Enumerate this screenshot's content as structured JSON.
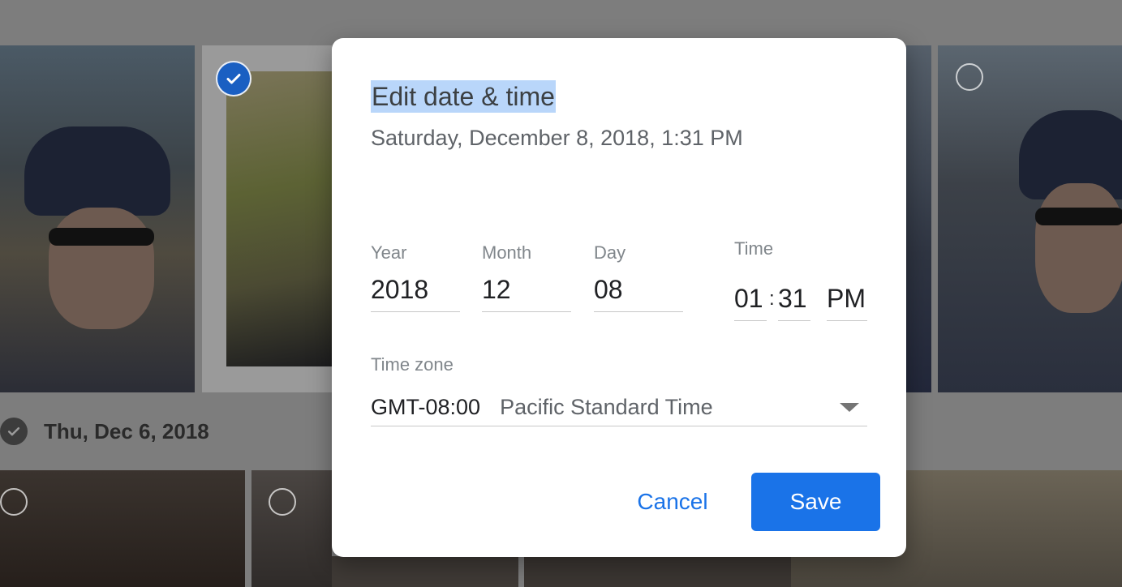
{
  "gallery": {
    "date_group_label": "Thu, Dec 6, 2018"
  },
  "dialog": {
    "title": "Edit date & time",
    "current_datetime": "Saturday, December 8, 2018, 1:31 PM",
    "fields": {
      "year_label": "Year",
      "year_value": "2018",
      "month_label": "Month",
      "month_value": "12",
      "day_label": "Day",
      "day_value": "08",
      "time_label": "Time",
      "hour_value": "01",
      "time_separator": ":",
      "minute_value": "31",
      "ampm_value": "PM"
    },
    "timezone": {
      "label": "Time zone",
      "offset": "GMT-08:00",
      "name": "Pacific Standard Time"
    },
    "buttons": {
      "cancel": "Cancel",
      "save": "Save"
    }
  },
  "colors": {
    "accent": "#1a73e8",
    "selection_badge": "#1a5fc2",
    "title_highlight": "#b9d6fa",
    "overlay": "#7d7d7d"
  },
  "icons": [
    "checkmark-icon",
    "selection-circle-icon",
    "dropdown-caret-icon"
  ]
}
